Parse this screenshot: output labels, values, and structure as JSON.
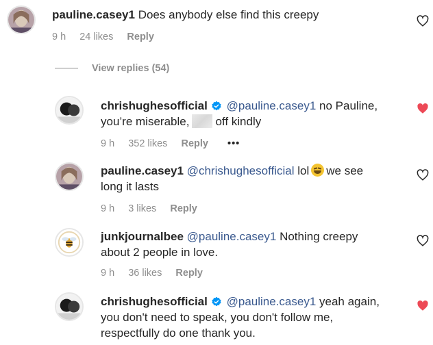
{
  "colors": {
    "like_red": "#ed4956",
    "mention_blue": "#3b5a8f",
    "meta_gray": "#8e8e8e"
  },
  "comments": [
    {
      "username": "pauline.casey1",
      "text": "Does anybody else find this creepy",
      "time": "9 h",
      "likes": "24 likes",
      "reply": "Reply",
      "liked": false
    },
    {
      "username": "chrishughesofficial",
      "verified": true,
      "mention": "@pauline.casey1",
      "text_a": "no Pauline,",
      "text_b": "you’re miserable,",
      "text_c": "off kindly",
      "time": "9 h",
      "likes": "352 likes",
      "reply": "Reply",
      "more": "•••",
      "liked": true
    },
    {
      "username": "pauline.casey1",
      "mention": "@chrishughesofficial",
      "text_a": "lol",
      "emoji": "grimacing-face",
      "text_b": "we see",
      "text_c": "long it lasts",
      "time": "9 h",
      "likes": "3 likes",
      "reply": "Reply",
      "liked": false
    },
    {
      "username": "junkjournalbee",
      "mention": "@pauline.casey1",
      "text_a": "Nothing creepy",
      "text_b": "about 2 people in love.",
      "time": "9 h",
      "likes": "36 likes",
      "reply": "Reply",
      "liked": false
    },
    {
      "username": "chrishughesofficial",
      "verified": true,
      "mention": "@pauline.casey1",
      "text_a": "yeah again,",
      "text_b": "you don't need to speak, you don't follow me,",
      "text_c": "respectfully do one thank you.",
      "liked": true
    }
  ],
  "view_replies": "View replies (54)"
}
